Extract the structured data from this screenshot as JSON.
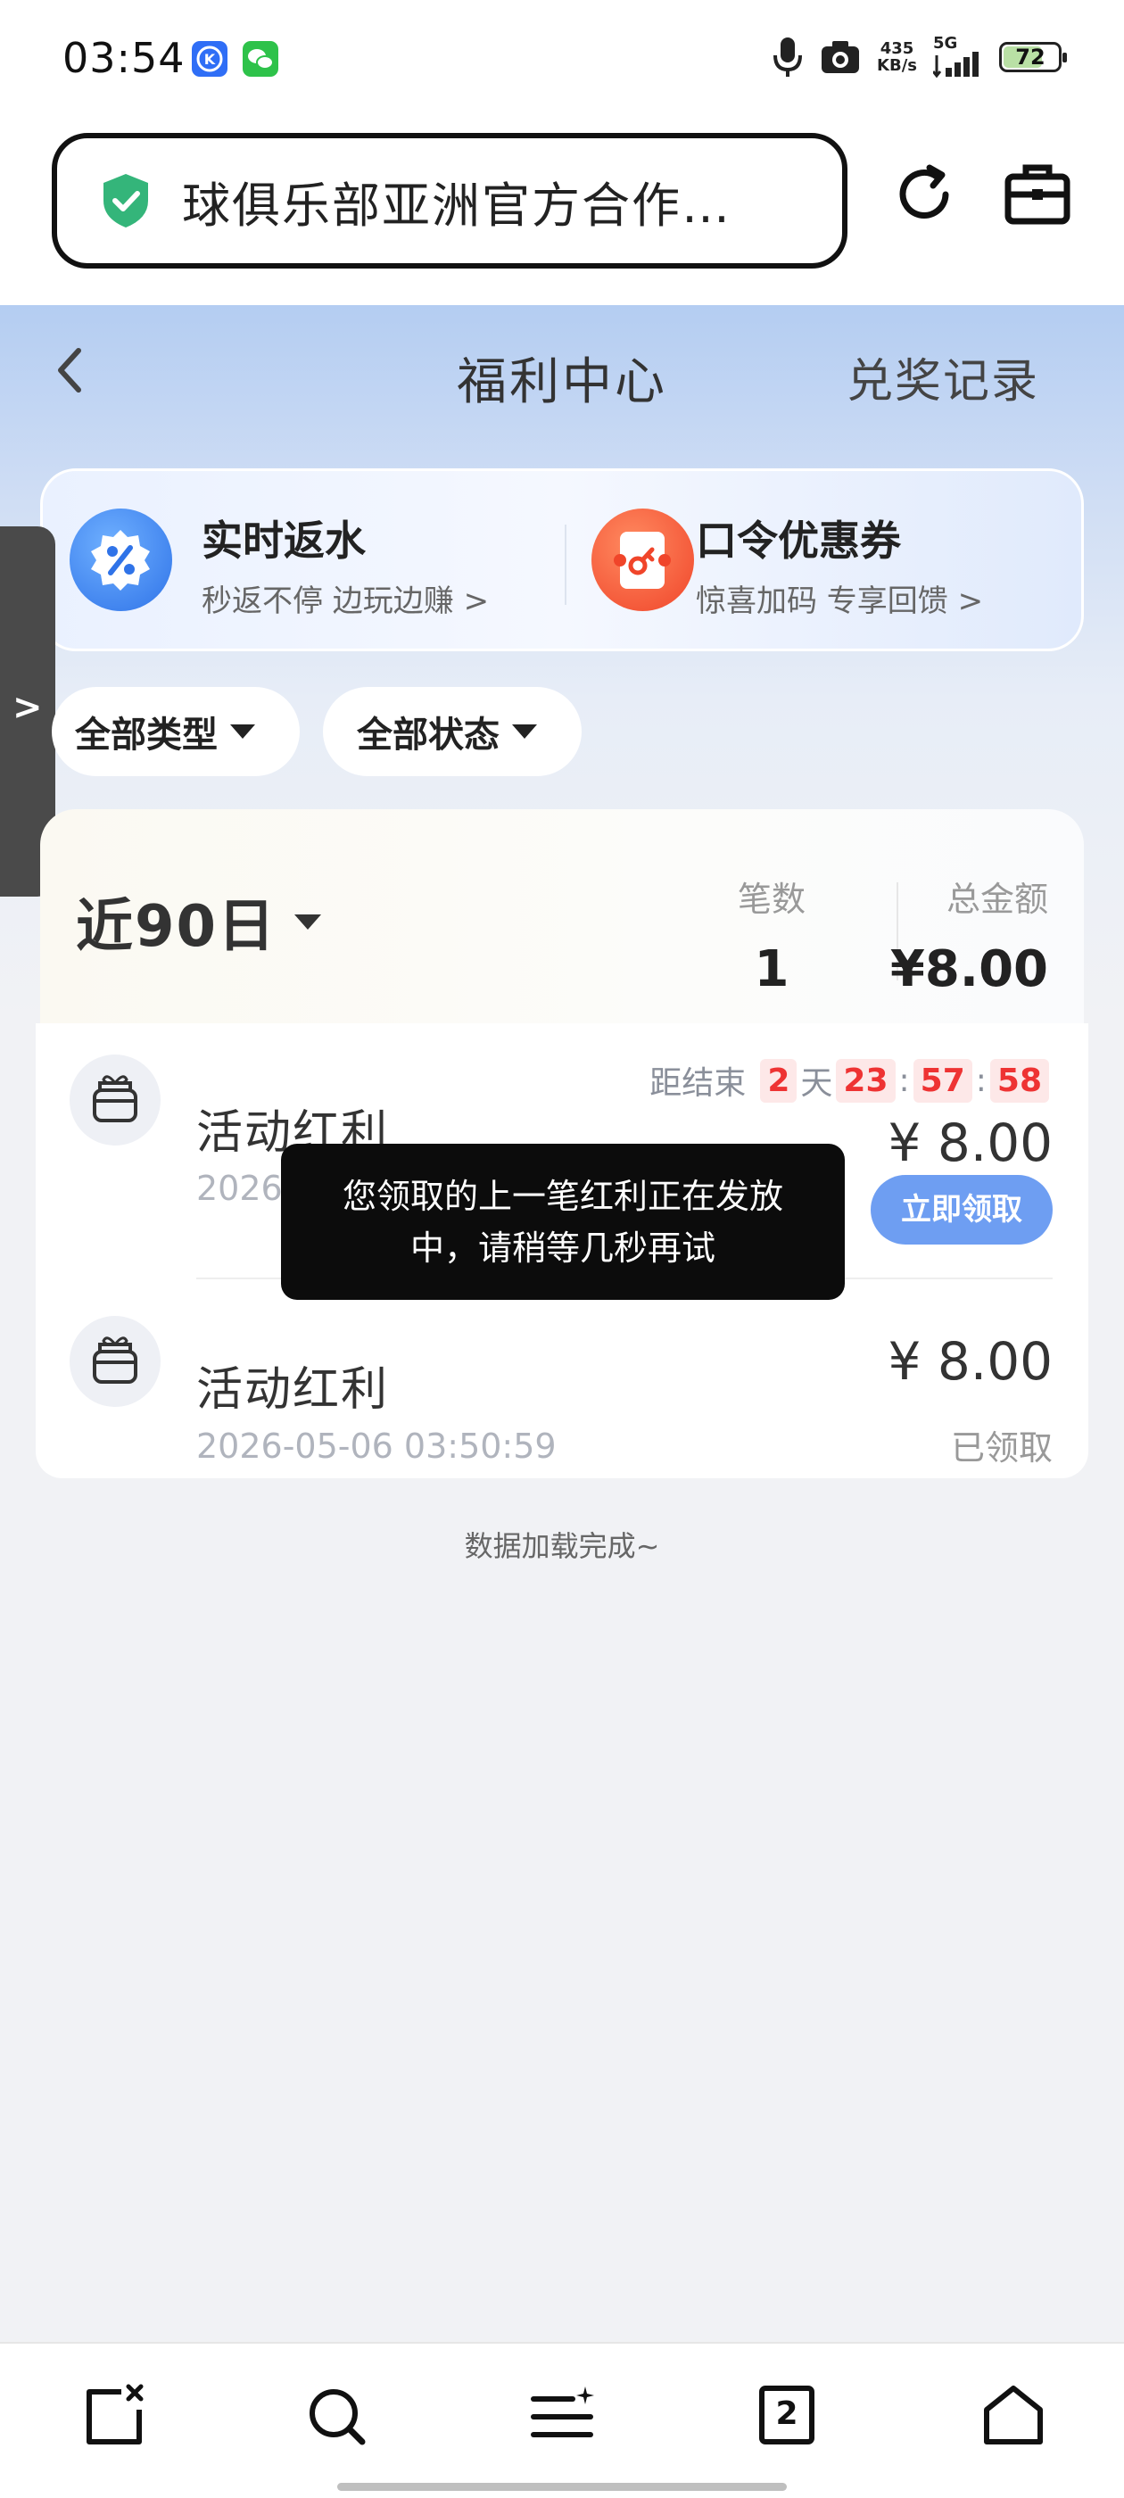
{
  "status_bar": {
    "time": "03:54",
    "speed_value": "435",
    "speed_unit": "KB/s",
    "network": "5G",
    "battery": "72",
    "battery_level": 0.72
  },
  "browser": {
    "url_title": "球俱乐部亚洲官方合作…"
  },
  "header": {
    "title": "福利中心",
    "records_link": "兑奖记录"
  },
  "promo": {
    "rebate": {
      "title": "实时返水",
      "subtitle": "秒返不停 边玩边赚 >"
    },
    "coupon": {
      "title": "口令优惠券",
      "subtitle": "惊喜加码 专享回馈 >"
    }
  },
  "filters": {
    "type": "全部类型",
    "status": "全部状态"
  },
  "summary": {
    "range": "近90日",
    "count_label": "笔数",
    "count_value": "1",
    "total_label": "总金额",
    "total_value": "¥8.00"
  },
  "list": [
    {
      "title": "活动红利",
      "date": "2026-",
      "amount": "¥ 8.00",
      "countdown_label": "距结束",
      "countdown_days": "2",
      "countdown_day_unit": "天",
      "countdown_h": "23",
      "countdown_m": "57",
      "countdown_s": "58",
      "action": "立即领取"
    },
    {
      "title": "活动红利",
      "date": "2026-05-06 03:50:59",
      "amount": "¥ 8.00",
      "status": "已领取"
    }
  ],
  "footer_text": "数据加载完成~",
  "toast": "您领取的上一笔红利正在发放中，请稍等几秒再试",
  "tabs_count": "2",
  "colors": {
    "accent_blue": "#6e9ef2",
    "countdown_red": "#e33333",
    "shield_green": "#34b57a"
  }
}
